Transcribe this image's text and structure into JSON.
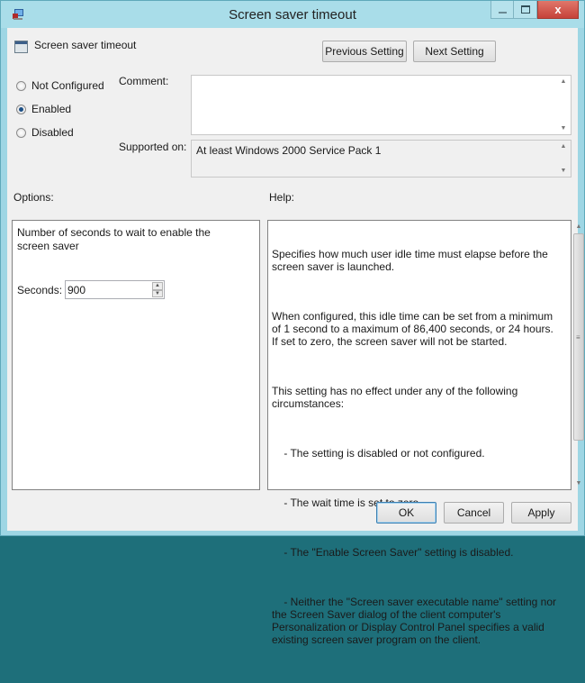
{
  "window": {
    "title": "Screen saver timeout",
    "controls": {
      "minimize": "minimize-icon",
      "maximize": "maximize-icon",
      "close": "close-icon"
    }
  },
  "header": {
    "policy_name": "Screen saver timeout",
    "previous_label": "Previous Setting",
    "next_label": "Next Setting"
  },
  "state": {
    "options": [
      {
        "label": "Not Configured",
        "selected": false
      },
      {
        "label": "Enabled",
        "selected": true
      },
      {
        "label": "Disabled",
        "selected": false
      }
    ]
  },
  "comment": {
    "label": "Comment:",
    "value": ""
  },
  "supported": {
    "label": "Supported on:",
    "value": "At least Windows 2000 Service Pack 1"
  },
  "options_panel": {
    "heading": "Options:",
    "description": "Number of seconds to wait to enable the screen saver",
    "seconds_label": "Seconds:",
    "seconds_value": "900"
  },
  "help_panel": {
    "heading": "Help:",
    "paragraphs": [
      "Specifies how much user idle time must elapse before the screen saver is launched.",
      "When configured, this idle time can be set from a minimum of 1 second to a maximum of 86,400 seconds, or 24 hours. If set to zero, the screen saver will not be started.",
      "This setting has no effect under any of the following circumstances:",
      "    - The setting is disabled or not configured.",
      "    - The wait time is set to zero.",
      "    - The \"Enable Screen Saver\" setting is disabled.",
      "    - Neither the \"Screen saver executable name\" setting nor the Screen Saver dialog of the client computer's Personalization or Display Control Panel specifies a valid existing screen saver program on the client."
    ]
  },
  "footer": {
    "ok_label": "OK",
    "cancel_label": "Cancel",
    "apply_label": "Apply"
  }
}
